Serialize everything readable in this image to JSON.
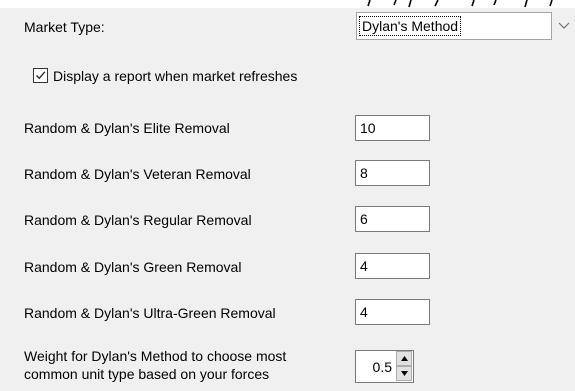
{
  "market": {
    "label": "Market Type:",
    "selected": "Dylan's Method"
  },
  "report_option": {
    "label": "Display a report when market refreshes",
    "checked": true
  },
  "removals": [
    {
      "label": "Random & Dylan's Elite Removal",
      "value": "10"
    },
    {
      "label": "Random & Dylan's Veteran Removal",
      "value": "8"
    },
    {
      "label": "Random & Dylan's Regular Removal",
      "value": "6"
    },
    {
      "label": "Random & Dylan's Green Removal",
      "value": "4"
    },
    {
      "label": "Random & Dylan's Ultra-Green Removal",
      "value": "4"
    }
  ],
  "weight": {
    "label_line1": "Weight for Dylan's Method to choose most",
    "label_line2": "common unit type based on your forces",
    "value": "0.5"
  },
  "icons": {
    "dropdown": "chevron-down-icon",
    "check": "checkmark-icon",
    "spin_up": "triangle-up-icon",
    "spin_down": "triangle-down-icon"
  },
  "colors": {
    "panel_background": "#f0f0f0",
    "field_background": "#ffffff",
    "field_border": "#7a7a7a"
  }
}
